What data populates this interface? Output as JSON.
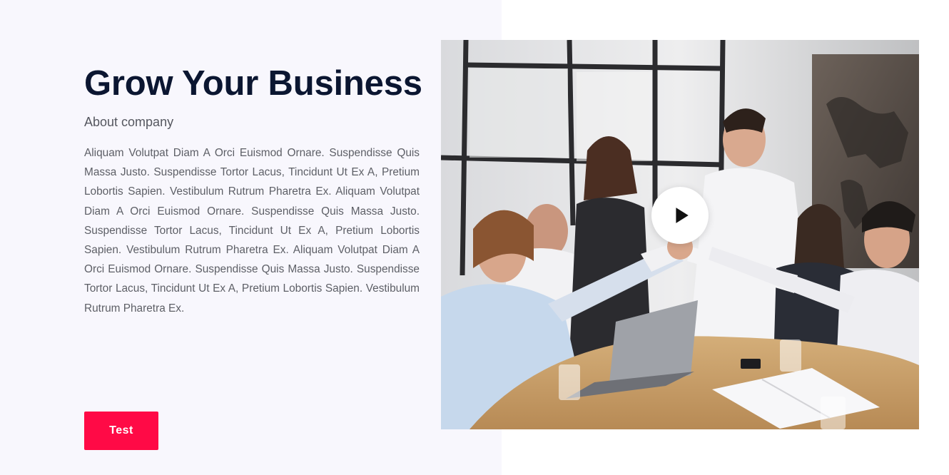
{
  "hero": {
    "title": "Grow Your Business",
    "subtitle": "About company",
    "description": "Aliquam Volutpat Diam A Orci Euismod Ornare. Suspendisse Quis Massa Justo. Suspendisse Tortor Lacus, Tincidunt Ut Ex A, Pretium Lobortis Sapien. Vestibulum Rutrum Pharetra Ex. Aliquam Volutpat Diam A Orci Euismod Ornare. Suspendisse Quis Massa Justo. Suspendisse Tortor Lacus, Tincidunt Ut Ex A, Pretium Lobortis Sapien. Vestibulum Rutrum Pharetra Ex. Aliquam Volutpat Diam A Orci Euismod Ornare. Suspendisse Quis Massa Justo. Suspendisse Tortor Lacus, Tincidunt Ut Ex A, Pretium Lobortis Sapien. Vestibulum Rutrum Pharetra Ex.",
    "button_label": "Test"
  },
  "video": {
    "play_icon": "play-icon",
    "thumbnail_icon": "team-meeting-photo"
  },
  "colors": {
    "panel_background": "#f8f7fd",
    "title": "#0b1631",
    "accent": "#ff0a46",
    "body_text": "#5d5f66"
  }
}
